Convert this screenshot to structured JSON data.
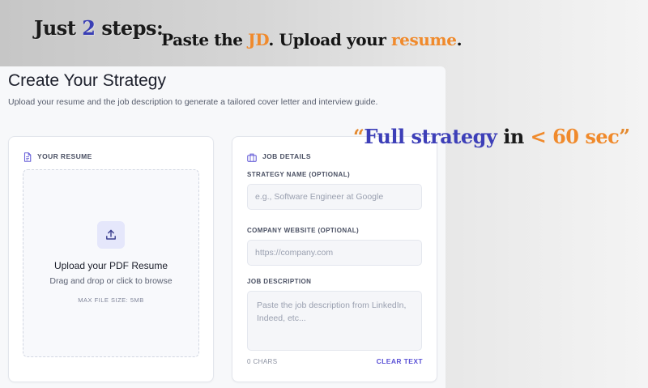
{
  "banner": {
    "steps_prefix": "Just ",
    "steps_number": "2",
    "steps_suffix": " steps:",
    "actions_part1": "Paste the ",
    "actions_jd": "JD",
    "actions_part2": ". Upload your ",
    "actions_resume": "resume",
    "actions_end": "."
  },
  "promo": {
    "open_quote": "“",
    "blue_text": "Full strategy",
    "mid_text": " in ",
    "orange_text": "< 60 sec",
    "close_quote": "”"
  },
  "page": {
    "title": "Create Your Strategy",
    "subtitle": "Upload your resume and the job description to generate a tailored cover letter and interview guide."
  },
  "resume_card": {
    "header": "YOUR RESUME",
    "icon": "document-icon",
    "upload_icon": "upload-icon",
    "drop_title": "Upload your PDF Resume",
    "drop_subtitle": "Drag and drop or click to browse",
    "max_size": "MAX FILE SIZE: 5MB"
  },
  "job_card": {
    "header": "JOB DETAILS",
    "icon": "briefcase-icon",
    "strategy_label": "STRATEGY NAME (OPTIONAL)",
    "strategy_placeholder": "e.g., Software Engineer at Google",
    "strategy_value": "",
    "website_label": "COMPANY WEBSITE (OPTIONAL)",
    "website_placeholder": "https://company.com",
    "website_value": "",
    "description_label": "JOB DESCRIPTION",
    "description_placeholder": "Paste the job description from LinkedIn, Indeed, etc...",
    "description_value": "",
    "chars_count": "0 CHARS",
    "clear_label": "CLEAR TEXT"
  },
  "colors": {
    "accent_orange": "#f08a2c",
    "accent_blue": "#3d3fb8",
    "link_purple": "#5b52d6",
    "icon_purple": "#6b63d9"
  }
}
